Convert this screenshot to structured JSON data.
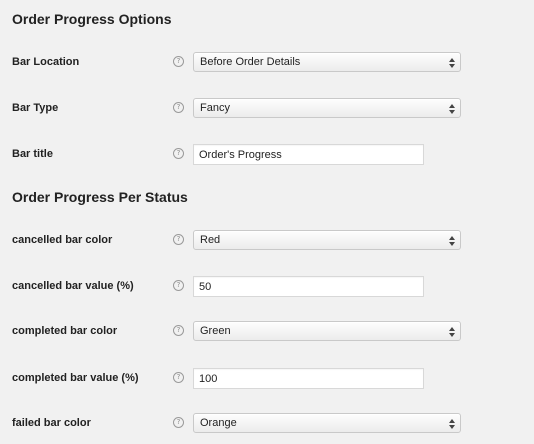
{
  "options_section": {
    "title": "Order Progress Options",
    "fields": [
      {
        "label": "Bar Location",
        "help": "?",
        "type": "select",
        "value": "Before Order Details"
      },
      {
        "label": "Bar Type",
        "help": "?",
        "type": "select",
        "value": "Fancy"
      },
      {
        "label": "Bar title",
        "help": "?",
        "type": "text",
        "value": "Order's Progress"
      }
    ]
  },
  "status_section": {
    "title": "Order Progress Per Status",
    "fields": [
      {
        "label": "cancelled bar color",
        "help": "?",
        "type": "select",
        "value": "Red"
      },
      {
        "label": "cancelled bar value (%)",
        "help": "?",
        "type": "text",
        "value": "50"
      },
      {
        "label": "completed bar color",
        "help": "?",
        "type": "select",
        "value": "Green"
      },
      {
        "label": "completed bar value (%)",
        "help": "?",
        "type": "text",
        "value": "100"
      },
      {
        "label": "failed bar color",
        "help": "?",
        "type": "select",
        "value": "Orange"
      }
    ]
  }
}
